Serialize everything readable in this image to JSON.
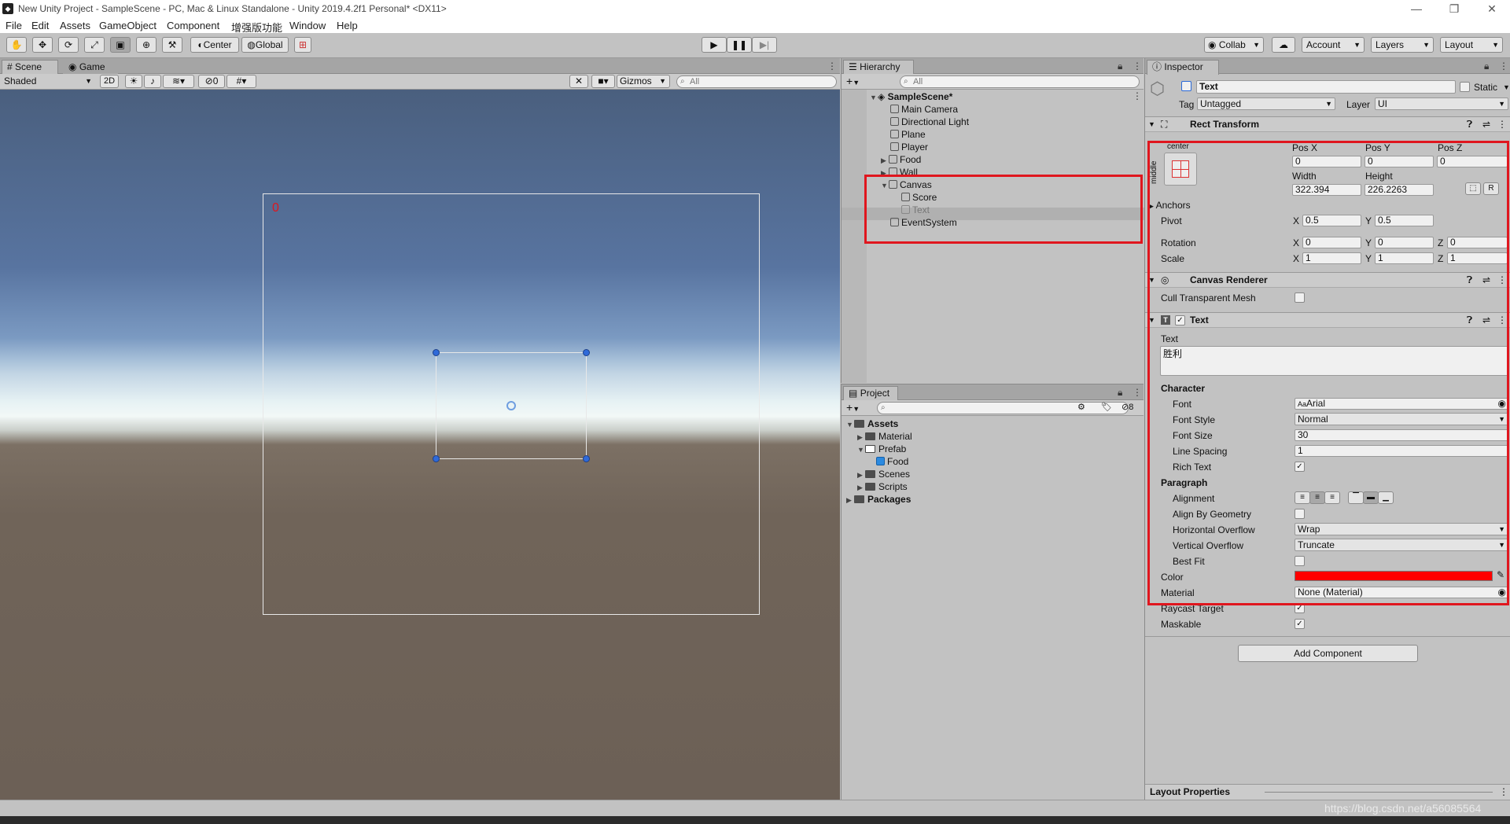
{
  "window": {
    "title": "New Unity Project - SampleScene - PC, Mac & Linux Standalone - Unity 2019.4.2f1 Personal* <DX11>",
    "minimize": "—",
    "maximize": "❐",
    "close": "✕"
  },
  "menu": [
    "File",
    "Edit",
    "Assets",
    "GameObject",
    "Component",
    "增强版功能",
    "Window",
    "Help"
  ],
  "toolbar": {
    "pivot_mode": "Center",
    "pivot_rotation": "Global",
    "collab": "Collab",
    "account": "Account",
    "layers": "Layers",
    "layout": "Layout"
  },
  "scene": {
    "tab_scene": "Scene",
    "tab_game": "Game",
    "shading": "Shaded",
    "mode_2d": "2D",
    "hidden_count": "0",
    "gizmos": "Gizmos",
    "search_placeholder": "All",
    "canvas_text": "0"
  },
  "hierarchy": {
    "tab": "Hierarchy",
    "search_placeholder": "All",
    "scene_name": "SampleScene*",
    "items": [
      {
        "label": "Main Camera"
      },
      {
        "label": "Directional Light"
      },
      {
        "label": "Plane"
      },
      {
        "label": "Player"
      },
      {
        "label": "Food"
      },
      {
        "label": "Wall"
      },
      {
        "label": "Canvas"
      },
      {
        "label": "Score"
      },
      {
        "label": "Text"
      },
      {
        "label": "EventSystem"
      }
    ]
  },
  "project": {
    "tab": "Project",
    "hidden_count": "8",
    "items": [
      {
        "label": "Assets"
      },
      {
        "label": "Material"
      },
      {
        "label": "Prefab"
      },
      {
        "label": "Food"
      },
      {
        "label": "Scenes"
      },
      {
        "label": "Scripts"
      },
      {
        "label": "Packages"
      }
    ]
  },
  "inspector": {
    "tab": "Inspector",
    "object_name": "Text",
    "static_label": "Static",
    "tag_label": "Tag",
    "tag_value": "Untagged",
    "layer_label": "Layer",
    "layer_value": "UI",
    "rect_transform": {
      "title": "Rect Transform",
      "anchor_h": "center",
      "anchor_v": "middle",
      "pos_x_label": "Pos X",
      "pos_x": "0",
      "pos_y_label": "Pos Y",
      "pos_y": "0",
      "pos_z_label": "Pos Z",
      "pos_z": "0",
      "width_label": "Width",
      "width": "322.394",
      "height_label": "Height",
      "height": "226.2263",
      "r_button": "R",
      "anchors": "Anchors",
      "pivot": "Pivot",
      "pivot_x": "0.5",
      "pivot_y": "0.5",
      "rotation": "Rotation",
      "rot_x": "0",
      "rot_y": "0",
      "rot_z": "0",
      "scale": "Scale",
      "scale_x": "1",
      "scale_y": "1",
      "scale_z": "1",
      "x": "X",
      "y": "Y",
      "z": "Z"
    },
    "canvas_renderer": {
      "title": "Canvas Renderer",
      "cull_label": "Cull Transparent Mesh"
    },
    "text_component": {
      "title": "Text",
      "text_label": "Text",
      "text_value": "胜利",
      "character": "Character",
      "font_label": "Font",
      "font_value": "Arial",
      "font_style_label": "Font Style",
      "font_style_value": "Normal",
      "font_size_label": "Font Size",
      "font_size_value": "30",
      "line_spacing_label": "Line Spacing",
      "line_spacing_value": "1",
      "rich_text_label": "Rich Text",
      "paragraph": "Paragraph",
      "alignment_label": "Alignment",
      "align_geometry_label": "Align By Geometry",
      "h_overflow_label": "Horizontal Overflow",
      "h_overflow_value": "Wrap",
      "v_overflow_label": "Vertical Overflow",
      "v_overflow_value": "Truncate",
      "best_fit_label": "Best Fit",
      "color_label": "Color",
      "color_value": "#ff0000",
      "material_label": "Material",
      "material_value": "None (Material)",
      "raycast_label": "Raycast Target",
      "maskable_label": "Maskable"
    },
    "add_component": "Add Component",
    "layout_properties": "Layout Properties"
  },
  "watermark": "https://blog.csdn.net/a56085564",
  "colors": {
    "highlight": "#e0161e",
    "text_color": "#ff0000"
  }
}
